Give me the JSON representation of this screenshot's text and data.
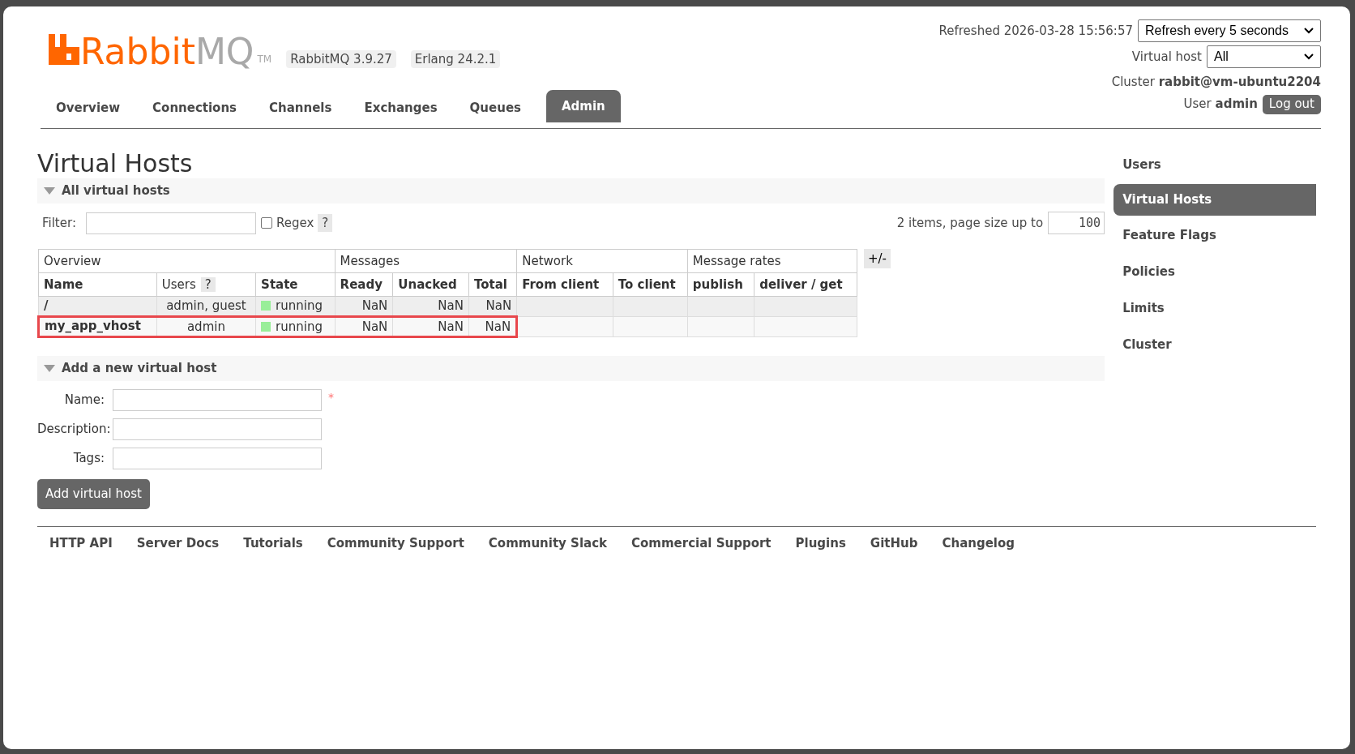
{
  "header": {
    "logo": {
      "brand_orange": "Rabbit",
      "brand_gray": "MQ",
      "tm": "TM"
    },
    "badges": [
      "RabbitMQ 3.9.27",
      "Erlang 24.2.1"
    ],
    "refreshed": "Refreshed 2026-03-28 15:56:57",
    "refresh_select": "Refresh every 5 seconds",
    "vhost_label": "Virtual host",
    "vhost_select": "All",
    "cluster_label": "Cluster",
    "cluster": "rabbit@vm-ubuntu2204",
    "user_label": "User",
    "user": "admin",
    "logout": "Log out"
  },
  "tabs": [
    {
      "label": "Overview",
      "selected": false
    },
    {
      "label": "Connections",
      "selected": false
    },
    {
      "label": "Channels",
      "selected": false
    },
    {
      "label": "Exchanges",
      "selected": false
    },
    {
      "label": "Queues",
      "selected": false
    },
    {
      "label": "Admin",
      "selected": true
    }
  ],
  "page_title": "Virtual Hosts",
  "all_section": {
    "title": "All virtual hosts",
    "expanded": true,
    "filter_label": "Filter:",
    "regex_label": "Regex",
    "regex_checked": false,
    "help": "?",
    "items_text": "2 items, page size up to",
    "page_size": "100",
    "table": {
      "groups": [
        "Overview",
        "Messages",
        "Network",
        "Message rates"
      ],
      "toggle": "+/-",
      "columns": [
        {
          "label": "Name"
        },
        {
          "label": "Users",
          "help": "?"
        },
        {
          "label": "State"
        },
        {
          "label": "Ready"
        },
        {
          "label": "Unacked"
        },
        {
          "label": "Total"
        },
        {
          "label": "From client"
        },
        {
          "label": "To client"
        },
        {
          "label": "publish"
        },
        {
          "label": "deliver / get"
        }
      ],
      "rows": [
        {
          "name": "/",
          "users": "admin, guest",
          "state": "running",
          "ready": "NaN",
          "unacked": "NaN",
          "total": "NaN",
          "highlighted": false
        },
        {
          "name": "my_app_vhost",
          "users": "admin",
          "state": "running",
          "ready": "NaN",
          "unacked": "NaN",
          "total": "NaN",
          "highlighted": true
        }
      ]
    }
  },
  "add_section": {
    "title": "Add a new virtual host",
    "expanded": true,
    "fields": [
      {
        "label": "Name:",
        "required_mark": "*"
      },
      {
        "label": "Description:"
      },
      {
        "label": "Tags:"
      }
    ],
    "button": "Add virtual host"
  },
  "sidebar": [
    {
      "label": "Users",
      "selected": false
    },
    {
      "label": "Virtual Hosts",
      "selected": true
    },
    {
      "label": "Feature Flags",
      "selected": false
    },
    {
      "label": "Policies",
      "selected": false
    },
    {
      "label": "Limits",
      "selected": false
    },
    {
      "label": "Cluster",
      "selected": false
    }
  ],
  "footer": [
    "HTTP API",
    "Server Docs",
    "Tutorials",
    "Community Support",
    "Community Slack",
    "Commercial Support",
    "Plugins",
    "GitHub",
    "Changelog"
  ]
}
